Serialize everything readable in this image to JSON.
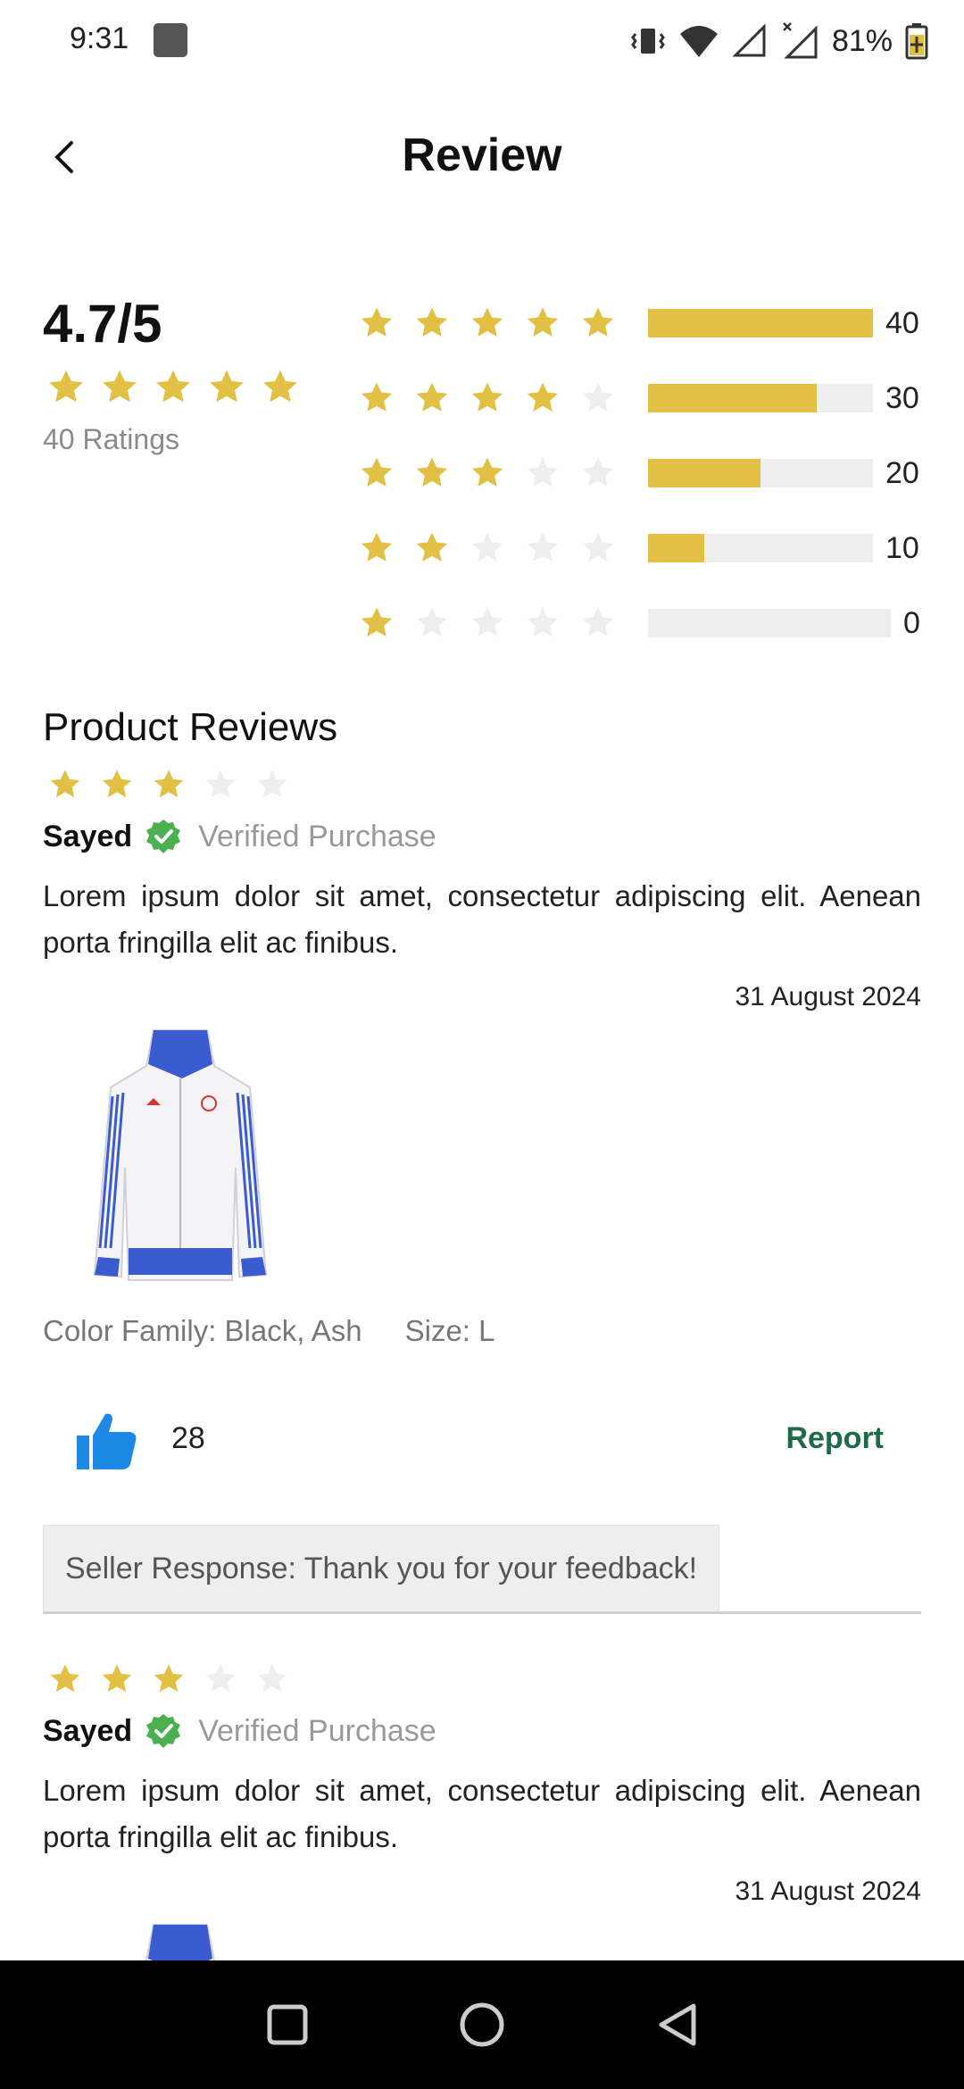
{
  "status_bar": {
    "time": "9:31",
    "battery": "81%",
    "icons": [
      "app-notification-icon",
      "vibrate-icon",
      "wifi-icon",
      "signal-icon",
      "signal-no-data-icon",
      "battery-charging-icon"
    ]
  },
  "app_bar": {
    "title": "Review",
    "back_icon": "back-arrow-icon"
  },
  "summary": {
    "score": "4.7/5",
    "stars": 5,
    "ratings_label": "40 Ratings",
    "distribution": [
      {
        "stars": 5,
        "count": "40",
        "fill": 1.0
      },
      {
        "stars": 4,
        "count": "30",
        "fill": 0.75
      },
      {
        "stars": 3,
        "count": "20",
        "fill": 0.5
      },
      {
        "stars": 2,
        "count": "10",
        "fill": 0.25
      },
      {
        "stars": 1,
        "count": "0",
        "fill": 0.0
      }
    ]
  },
  "section": {
    "title": "Product Reviews"
  },
  "reviews": [
    {
      "stars": 3,
      "name": "Sayed",
      "verified": "Verified Purchase",
      "body": "Lorem ipsum dolor sit amet, consectetur adipiscing elit. Aenean porta fringilla elit ac finibus.",
      "date": "31 August 2024",
      "color_family": "Color Family: Black, Ash",
      "size": "Size: L",
      "likes": "28",
      "report": "Report",
      "seller_response": "Seller Response: Thank you for your feedback!"
    },
    {
      "stars": 3,
      "name": "Sayed",
      "verified": "Verified Purchase",
      "body": "Lorem ipsum dolor sit amet, consectetur adipiscing elit. Aenean porta fringilla elit ac finibus.",
      "date": "31 August 2024"
    }
  ],
  "nav_bar": {
    "icons": [
      "recents-square-icon",
      "home-circle-icon",
      "back-triangle-icon"
    ]
  },
  "colors": {
    "star_filled": "#e2c044",
    "star_empty": "#eeeeee",
    "bar_fill": "#e2c044",
    "bar_track": "#eeeeee",
    "verified_green": "#4caf50",
    "like_blue": "#1e88e5",
    "report_green": "#1e6b4a"
  }
}
